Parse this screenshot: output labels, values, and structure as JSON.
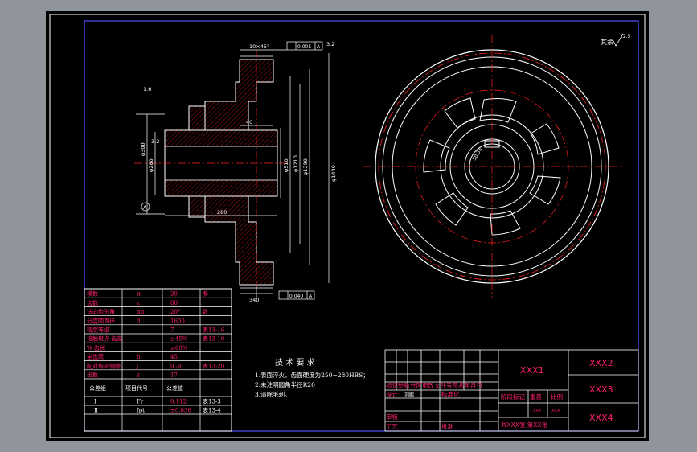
{
  "drawing": {
    "roughness_mark": "其余",
    "roughness_value": "12.5",
    "dims": {
      "top_chamfer": "10×45°",
      "tol_top": "0.005",
      "tol_top_ref": "A",
      "rough_top": "3.2",
      "rough_web": "1.6",
      "rough_bore": "3.2",
      "d_hub_outer": "φ300",
      "d_bore": "φ280",
      "width_40": "40",
      "width_280": "280",
      "width_340": "340",
      "d_web": "φ510",
      "d_web2": "φ1210",
      "d_rim_in": "φ1390",
      "d_rim_out": "φ1440",
      "tol_bottom": "0.040",
      "tol_bottom_ref": "A",
      "datum": "A",
      "keyway": "50.35"
    }
  },
  "param_table": {
    "rows": [
      {
        "name": "模数",
        "sym": "m",
        "val": "20",
        "note": "参"
      },
      {
        "name": "齿数",
        "sym": "z",
        "val": "80",
        "note": ""
      },
      {
        "name": "法向齿形角",
        "sym": "αn",
        "val": "20°",
        "note": "数"
      },
      {
        "name": "分度圆直径",
        "sym": "d",
        "val": "1600",
        "note": ""
      },
      {
        "name": "精度等级",
        "sym": "",
        "val": "7",
        "note": "表13-16"
      },
      {
        "name": "接触斑点 齿高",
        "sym": "",
        "val": "≥45%",
        "note": "表13-10"
      },
      {
        "name": "% 齿长",
        "sym": "",
        "val": "≥60%",
        "note": ""
      },
      {
        "name": "全齿高",
        "sym": "h",
        "val": "45",
        "note": ""
      },
      {
        "name": "配对齿轮侧隙",
        "sym": "j",
        "val": "0.36",
        "note": "表13-20"
      },
      {
        "name": "齿数",
        "sym": "z",
        "val": "17",
        "note": ""
      }
    ],
    "group_header": {
      "name": "公差组",
      "sym": "项目代号",
      "val": "公差值"
    },
    "group_rows": [
      {
        "name": "Ⅰ",
        "sym": "Fr",
        "val": "0.112",
        "note": "表13-3"
      },
      {
        "name": "Ⅱ",
        "sym": "fpt",
        "val": "±0.036",
        "note": "表13-4"
      }
    ]
  },
  "tech_req": {
    "title": "技 术 要 求",
    "items": [
      "1.表面淬火，齿面硬度为250~280HBS；",
      "2.未注明圆角半径R20",
      "3.清除毛刺。"
    ]
  },
  "title_block": {
    "xxx1": "XXX1",
    "xxx2": "XXX2",
    "xxx3": "XXX3",
    "xxx4": "XXX4",
    "revision_header": "标记处数分区更改文件号签名年月日",
    "design": "设计",
    "design_name": "刘鹏",
    "standard": "标准化",
    "review": "审核",
    "process": "工艺",
    "approve": "批准",
    "stage_mark": "阶段标记",
    "weight": "重量",
    "scale": "比例",
    "weight_val": "XXX",
    "scale_val": "XXX",
    "sheet_info": "共XXX张 第XX张"
  }
}
